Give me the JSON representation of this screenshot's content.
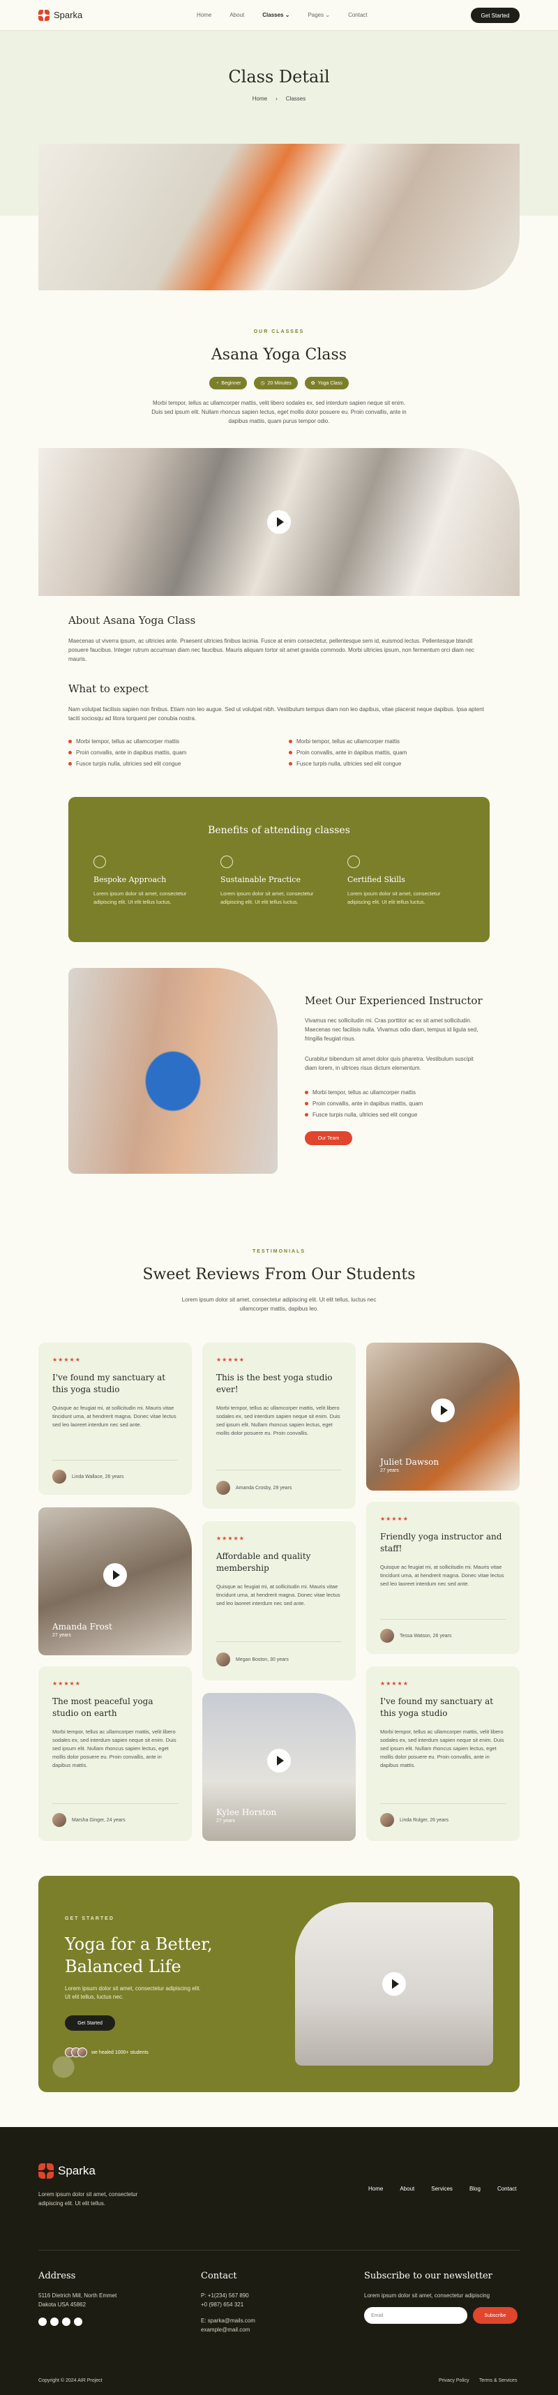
{
  "brand": {
    "name": "Sparka",
    "accent": "#7b7f2a",
    "accent_red": "#e0452d"
  },
  "nav": {
    "items": [
      "Home",
      "About",
      "Classes",
      "Pages",
      "Contact"
    ],
    "cta": "Get Started"
  },
  "hero": {
    "title": "Class Detail",
    "breadcrumb": [
      "Home",
      "Classes"
    ]
  },
  "class": {
    "overline": "OUR CLASSES",
    "title": "Asana Yoga Class",
    "pills": [
      "Beginner",
      "20 Minutes",
      "Yoga Class"
    ],
    "intro": "Morbi tempor, tellus ac ullamcorper mattis, velit libero sodales ex, sed interdum sapien neque sit enim. Duis sed ipsum elit. Nullam rhoncus sapien lectus, eget mollis dolor posuere eu. Proin convallis, ante in dapibus mattis, quam purus tempor odio.",
    "about_title": "About Asana Yoga Class",
    "about_text": "Maecenas ut viverra ipsum, ac ultricies ante. Praesent ultricies finibus lacinia. Fusce at enim consectetur, pellentesque sem id, euismod lectus. Pellentesque blandit posuere faucibus. Integer rutrum accumsan diam nec faucibus. Mauris aliquam tortor sit amet gravida commodo. Morbi ultricies ipsum, non fermentum orci diam nec mauris.",
    "expect_title": "What to expect",
    "expect_text": "Nam volutpat facilisis sapien non finibus. Etiam non leo augue. Sed ut volutpat nibh. Vestibulum tempus diam non leo dapibus, vitae placerat neque dapibus. Ipsa aptent taciti sociosqu ad litora torquent per conubia nostra.",
    "expect_left": [
      "Morbi tempor, tellus ac ullamcorper mattis",
      "Proin convallis, ante in dapibus mattis, quam",
      "Fusce turpis nulla, ultricies sed elit congue"
    ],
    "expect_right": [
      "Morbi tempor, tellus ac ullamcorper mattis",
      "Proin convallis, ante in dapibus mattis, quam",
      "Fusce turpis nulla, ultricies sed elit congue"
    ]
  },
  "benefits": {
    "title": "Benefits of attending classes",
    "items": [
      {
        "title": "Bespoke Approach",
        "text": "Lorem ipsum dolor sit amet, consectetur adipiscing elit. Ut elit tellus luctus."
      },
      {
        "title": "Sustainable Practice",
        "text": "Lorem ipsum dolor sit amet, consectetur adipiscing elit. Ut elit tellus luctus."
      },
      {
        "title": "Certified Skills",
        "text": "Lorem ipsum dolor sit amet, consectetur adipiscing elit. Ut elit tellus luctus."
      }
    ]
  },
  "instructor": {
    "title": "Meet Our Experienced Instructor",
    "p1": "Vivamus nec sollicitudin mi. Cras porttitor ac ex sit amet sollicitudin. Maecenas nec facilisis nulla. Vivamus odio diam, tempus id ligula sed, fringilla feugiat risus.",
    "p2": "Curabitur bibendum sit amet dolor quis pharetra. Vestibulum suscipit diam lorem, in ultrices risus dictum elementum.",
    "bullets": [
      "Morbi tempor, tellus ac ullamcorper mattis",
      "Proin convallis, ante in dapibus mattis, quam",
      "Fusce turpis nulla, ultricies sed elit congue"
    ],
    "button": "Our Team"
  },
  "testimonials": {
    "overline": "TESTIMONIALS",
    "title": "Sweet Reviews From Our Students",
    "subtitle": "Lorem ipsum dolor sit amet, consectetur adipiscing elit. Ut elit tellus, luctus nec ullamcorper mattis, dapibus leo.",
    "stars": "★★★★★",
    "cards": [
      {
        "title": "I've found my sanctuary at this yoga studio",
        "text": "Quisque ac feugiat mi, at sollicitudin mi. Mauris vitae tincidunt urna, at hendrerit magna. Donec vitae lectus sed leo laoreet interdum nec sed ante.",
        "author": "Linda Wallace, 26 years"
      },
      {
        "title": "This is the best yoga studio ever!",
        "text": "Morbi tempor, tellus ac ullamcorper mattis, velit libero sodales ex, sed interdum sapien neque sit enim. Duis sed ipsum elit. Nullam rhoncus sapien lectus, eget mollis dolor posuere eu. Proin convallis.",
        "author": "Amanda Crosby, 28 years"
      },
      {
        "title": "Friendly yoga instructor and staff!",
        "text": "Quisque ac feugiat mi, at sollicitudin mi. Mauris vitae tincidunt urna, at hendrerit magna. Donec vitae lectus sed leo laoreet interdum nec sed ante.",
        "author": "Tessa Watson, 26 years"
      },
      {
        "title": "Affordable and quality membership",
        "text": "Quisque ac feugiat mi, at sollicitudin mi. Mauris vitae tincidunt urna, at hendrerit magna. Donec vitae lectus sed leo laoreet interdum nec sed ante.",
        "author": "Megan Boston, 30 years"
      },
      {
        "title": "The most peaceful yoga studio on earth",
        "text": "Morbi tempor, tellus ac ullamcorper mattis, velit libero sodales ex, sed interdum sapien neque sit enim. Duis sed ipsum elit. Nullam rhoncus sapien lectus, eget mollis dolor posuere eu. Proin convallis, ante in dapibus mattis.",
        "author": "Marsha Ginger, 24 years"
      },
      {
        "title": "I've found my sanctuary at this yoga studio",
        "text": "Morbi tempor, tellus ac ullamcorper mattis, velit libero sodales ex, sed interdum sapien neque sit enim. Duis sed ipsum elit. Nullam rhoncus sapien lectus, eget mollis dolor posuere eu. Proin convallis, ante in dapibus mattis.",
        "author": "Linda Rulger, 26 years"
      }
    ],
    "videos": [
      {
        "name": "Juliet Dawson",
        "age": "27 years"
      },
      {
        "name": "Amanda Frost",
        "age": "27 years"
      },
      {
        "name": "Kylee Horston",
        "age": "27 years"
      }
    ]
  },
  "cta": {
    "overline": "GET STARTED",
    "title": "Yoga for a Better, Balanced Life",
    "text": "Lorem ipsum dolor sit amet, consectetur adipiscing elit. Ut elit tellus, luctus nec.",
    "button": "Get Started",
    "joined": "we healed 1000+ students"
  },
  "footer": {
    "tagline": "Lorem ipsum dolor sit amet, consectetur adipiscing elit. Ut elit tellus.",
    "nav": [
      "Home",
      "About",
      "Services",
      "Blog",
      "Contact"
    ],
    "address_title": "Address",
    "address": [
      "5116 Dietrich Mill, North Emmet",
      "Dakota USA 45862"
    ],
    "contact_title": "Contact",
    "phones": [
      "P: +1(234) 567 890",
      "+0 (987) 654 321"
    ],
    "emails": [
      "E: sparka@mails.com",
      "example@mail.com"
    ],
    "subscribe_title": "Subscribe to our newsletter",
    "subscribe_text": "Lorem ipsum dolor sit amet, consectetur adipiscing",
    "email_placeholder": "Email",
    "subscribe_button": "Subscribe",
    "copyright": "Copyright © 2024 AIR Project",
    "legal": [
      "Privacy Policy",
      "Terms & Services"
    ]
  }
}
